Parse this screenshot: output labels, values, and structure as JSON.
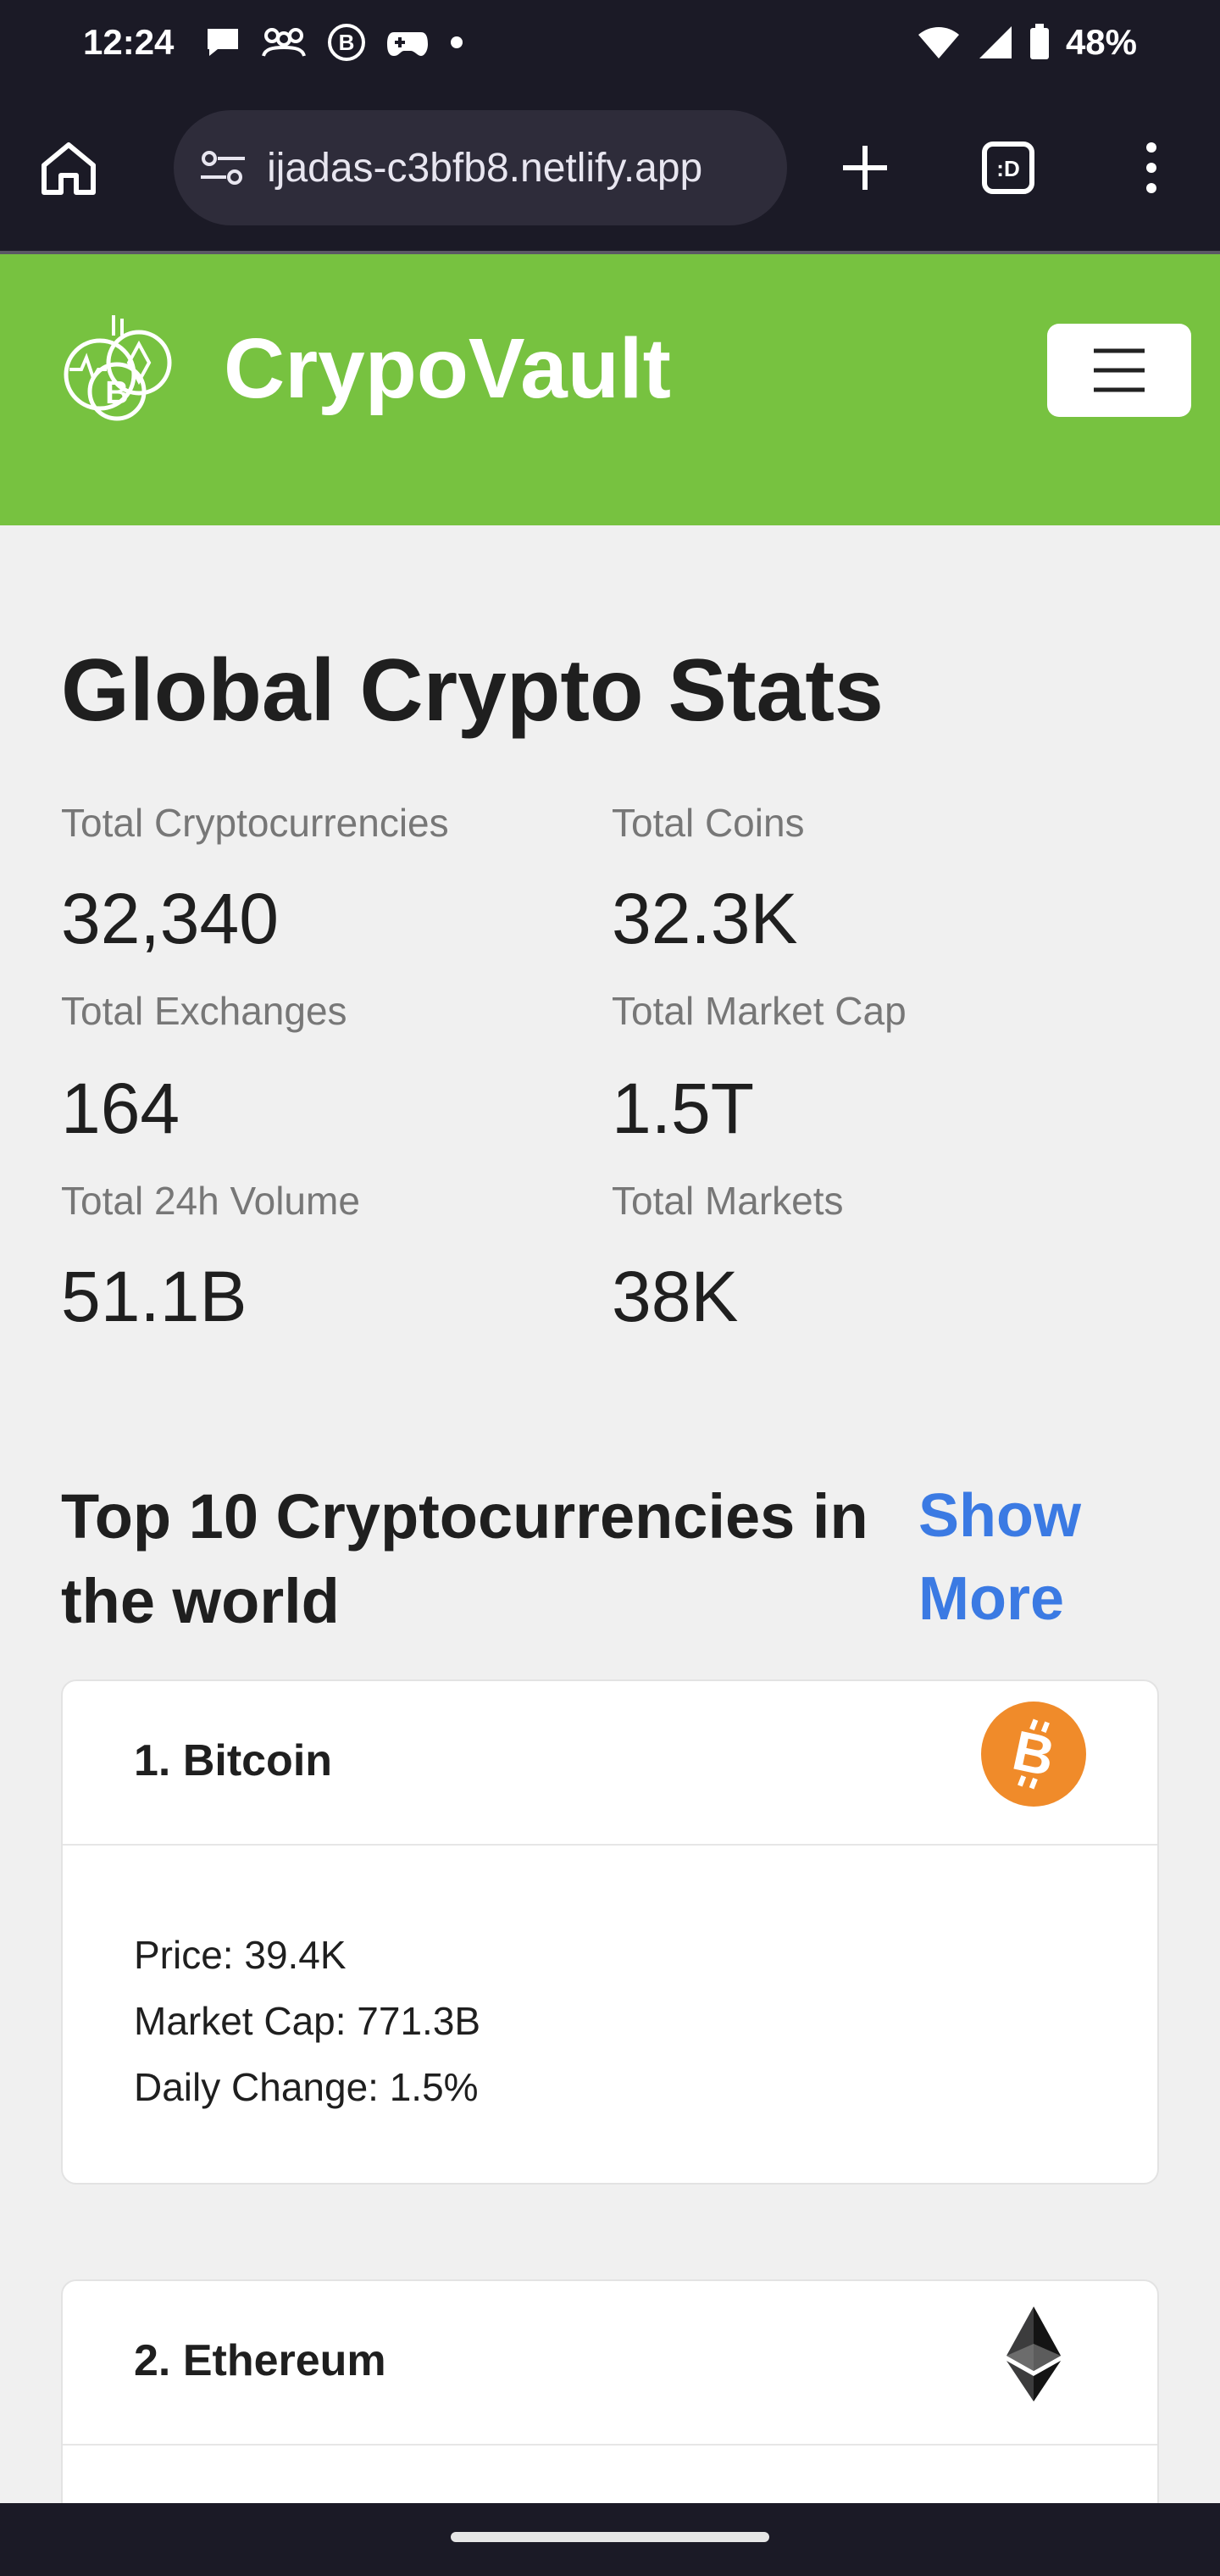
{
  "status_bar": {
    "time": "12:24",
    "battery": "48%",
    "left_icons": [
      "chat-bubble-icon",
      "groups-icon",
      "b-circle-icon",
      "gamepad-icon",
      "dot-icon"
    ],
    "right_icons": [
      "wifi-icon",
      "signal-icon",
      "battery-icon"
    ]
  },
  "browser": {
    "url": "ijadas-c3bfb8.netlify.app",
    "icons": [
      "home-icon",
      "site-settings-icon",
      "new-tab-plus-icon",
      "tab-switcher-icon",
      "overflow-menu-icon"
    ]
  },
  "navbar": {
    "brand": "CrypoVault",
    "bg_color": "#77c240",
    "toggler_icon": "hamburger-icon"
  },
  "global_stats": {
    "title": "Global Crypto Stats",
    "items": [
      {
        "label": "Total Cryptocurrencies",
        "value": "32,340"
      },
      {
        "label": "Total Coins",
        "value": "32.3K"
      },
      {
        "label": "Total Exchanges",
        "value": "164"
      },
      {
        "label": "Total Market Cap",
        "value": "1.5T"
      },
      {
        "label": "Total 24h Volume",
        "value": "51.1B"
      },
      {
        "label": "Total Markets",
        "value": "38K"
      }
    ]
  },
  "top_section": {
    "title_line1": "Top 10 Cryptocurrencies in",
    "title_line2": "the world",
    "show_more_line1": "Show",
    "show_more_line2": "More",
    "link_color": "#3b7ae3"
  },
  "cards": [
    {
      "title": "1. Bitcoin",
      "icon": "bitcoin-icon",
      "price": "Price: 39.4K",
      "market_cap": "Market Cap: 771.3B",
      "daily_change": "Daily Change: 1.5%"
    },
    {
      "title": "2. Ethereum",
      "icon": "ethereum-icon"
    }
  ]
}
